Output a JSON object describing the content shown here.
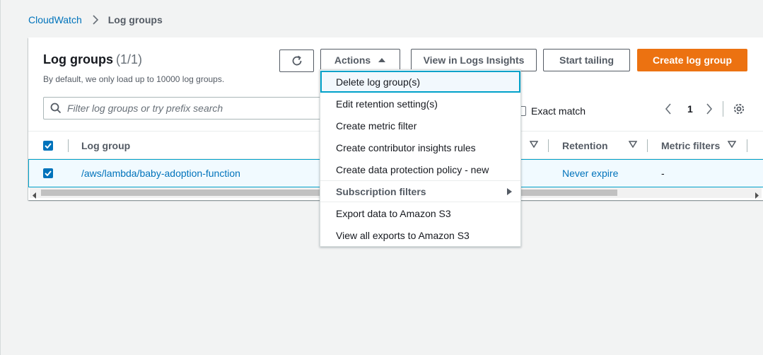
{
  "breadcrumb": {
    "root": "CloudWatch",
    "current": "Log groups"
  },
  "panel": {
    "title": "Log groups",
    "count": "(1/1)",
    "description": "By default, we only load up to 10000 log groups."
  },
  "toolbar": {
    "actions_label": "Actions",
    "insights_label": "View in Logs Insights",
    "tail_label": "Start tailing",
    "create_label": "Create log group"
  },
  "search": {
    "placeholder": "Filter log groups or try prefix search"
  },
  "exact_match_label": "Exact match",
  "pagination": {
    "page": "1"
  },
  "table": {
    "columns": [
      "Log group",
      "Retention",
      "Metric filters"
    ],
    "rows": [
      {
        "log_group": "/aws/lambda/baby-adoption-function",
        "retention": "Never expire",
        "metric_filters": "-"
      }
    ]
  },
  "actions_menu": {
    "items": [
      "Delete log group(s)",
      "Edit retention setting(s)",
      "Create metric filter",
      "Create contributor insights rules",
      "Create data protection policy - new",
      "Subscription filters",
      "Export data to Amazon S3",
      "View all exports to Amazon S3"
    ]
  },
  "colors": {
    "accent": "#0073bb",
    "primary_button": "#ec7211",
    "selection_border": "#00a1c9"
  }
}
